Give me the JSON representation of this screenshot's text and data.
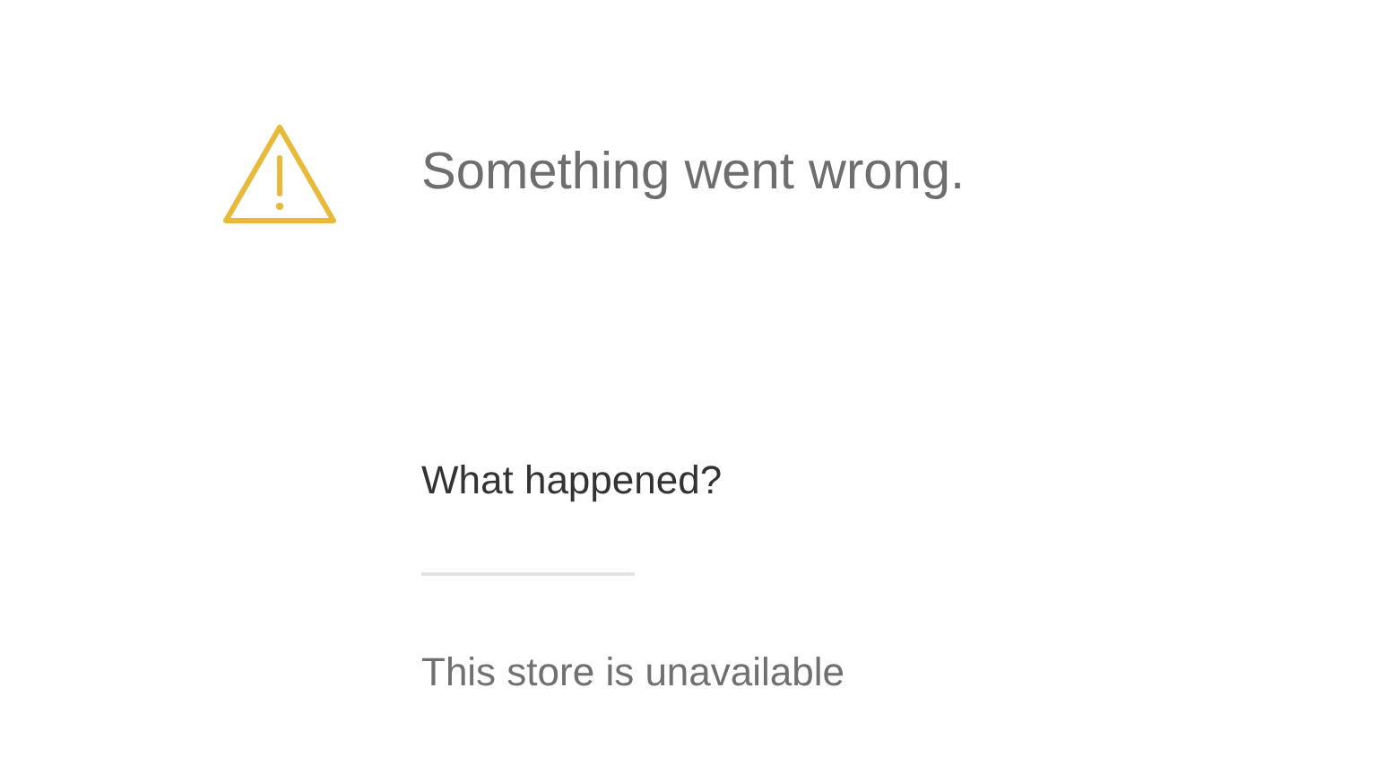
{
  "error": {
    "title": "Something went wrong."
  },
  "details": {
    "heading": "What happened?",
    "message": "This store is unavailable"
  }
}
